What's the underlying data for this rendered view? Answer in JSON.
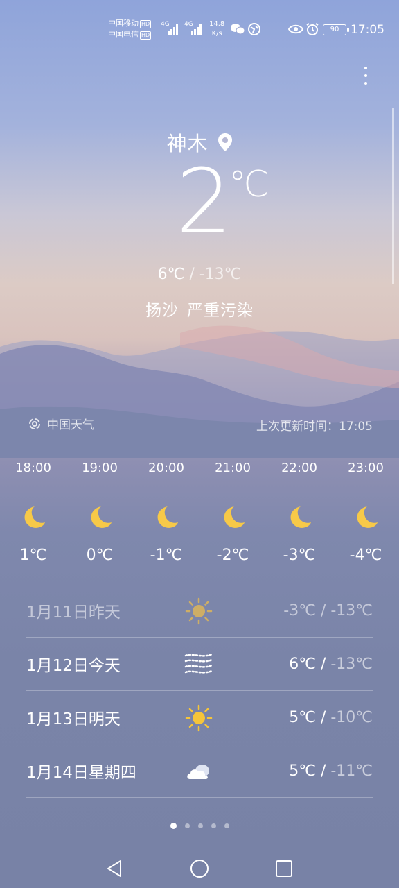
{
  "status_bar": {
    "carrier_1": "中国移动",
    "carrier_2": "中国电信",
    "hd_badge": "HD",
    "net_type": "4G",
    "speed_value": "14.8",
    "speed_unit": "K/s",
    "battery": "90",
    "time": "17:05"
  },
  "location": {
    "city": "神木"
  },
  "current": {
    "temperature": "2",
    "unit": "℃",
    "high": "6℃",
    "separator": "/",
    "low": "-13℃",
    "condition": "扬沙",
    "air_quality": "严重污染"
  },
  "source": {
    "provider": "中国天气",
    "updated_label": "上次更新时间：17:05"
  },
  "hourly": [
    {
      "time": "18:00",
      "icon": "moon-icon",
      "temp": "1℃"
    },
    {
      "time": "19:00",
      "icon": "moon-icon",
      "temp": "0℃"
    },
    {
      "time": "20:00",
      "icon": "moon-icon",
      "temp": "-1℃"
    },
    {
      "time": "21:00",
      "icon": "moon-icon",
      "temp": "-2℃"
    },
    {
      "time": "22:00",
      "icon": "moon-icon",
      "temp": "-3℃"
    },
    {
      "time": "23:00",
      "icon": "moon-icon",
      "temp": "-4℃"
    }
  ],
  "daily": [
    {
      "date": "1月11日昨天",
      "icon": "sun-icon",
      "high": "-3℃",
      "sep": "/",
      "low": "-13℃"
    },
    {
      "date": "1月12日今天",
      "icon": "sandstorm-icon",
      "high": "6℃",
      "sep": "/",
      "low": "-13℃"
    },
    {
      "date": "1月13日明天",
      "icon": "sun-icon",
      "high": "5℃",
      "sep": "/",
      "low": "-10℃"
    },
    {
      "date": "1月14日星期四",
      "icon": "cloudy-icon",
      "high": "5℃",
      "sep": "/",
      "low": "-11℃"
    }
  ],
  "pager": {
    "count": 5,
    "active": 0
  },
  "colors": {
    "sun": "#f6c53a",
    "moon": "#f7c948",
    "sky_top": "#8fa4da",
    "sky_bottom": "#7882a6"
  }
}
